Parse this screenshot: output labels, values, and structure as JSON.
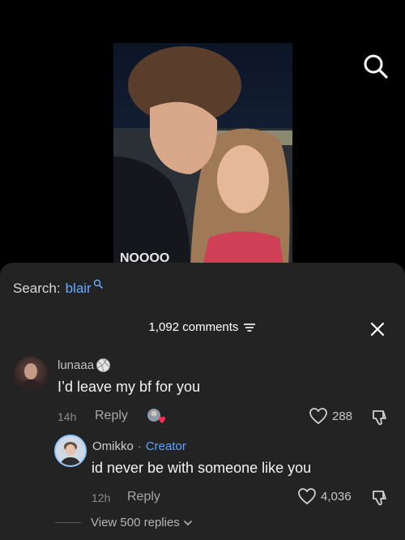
{
  "search": {
    "prefix": "Search:",
    "term": "blair"
  },
  "comments_header": {
    "count_label": "1,092 comments"
  },
  "comments": [
    {
      "username": "lunaaa",
      "text": "I’d leave my bf for you",
      "time": "14h",
      "reply_label": "Reply",
      "likes": "288"
    }
  ],
  "reply": {
    "username": "Omikko",
    "separator": "·",
    "creator_label": "Creator",
    "text": "id never be with someone like you",
    "time": "12h",
    "reply_label": "Reply",
    "likes": "4,036"
  },
  "view_replies_label": "View 500 replies",
  "icons": [
    "search-icon",
    "filter-icon",
    "close-icon",
    "heart-icon",
    "dislike-icon",
    "volleyball-badge-icon",
    "chevron-down-icon"
  ],
  "colors": {
    "sheet": "#232323",
    "link": "#68a9ff",
    "creator": "#5ea6ff",
    "liked_heart": "#ff2d55"
  }
}
